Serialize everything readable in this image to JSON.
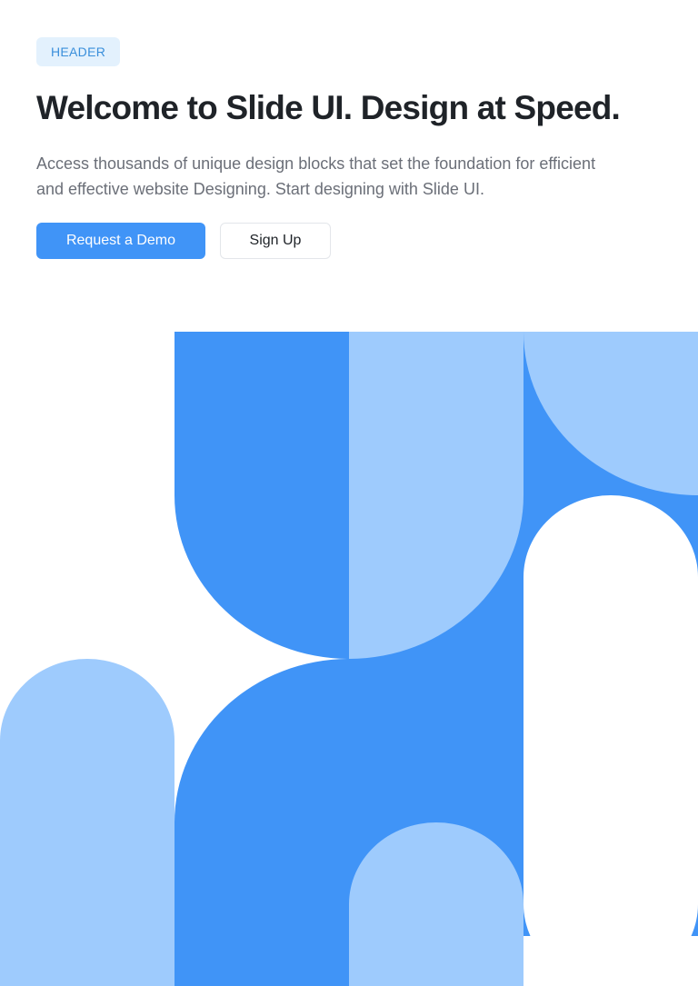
{
  "header": {
    "badge": "HEADER",
    "title": "Welcome to Slide UI. Design at Speed.",
    "description": "Access thousands of unique design blocks that set the foundation for efficient and effective website Designing. Start designing with Slide UI."
  },
  "actions": {
    "primary_label": "Request a Demo",
    "secondary_label": "Sign Up"
  },
  "colors": {
    "brand_blue": "#4094F7",
    "light_blue": "#9ECBFD",
    "badge_bg": "#E3F1FD",
    "heading": "#1F2328",
    "body_text": "#6B6F78"
  }
}
